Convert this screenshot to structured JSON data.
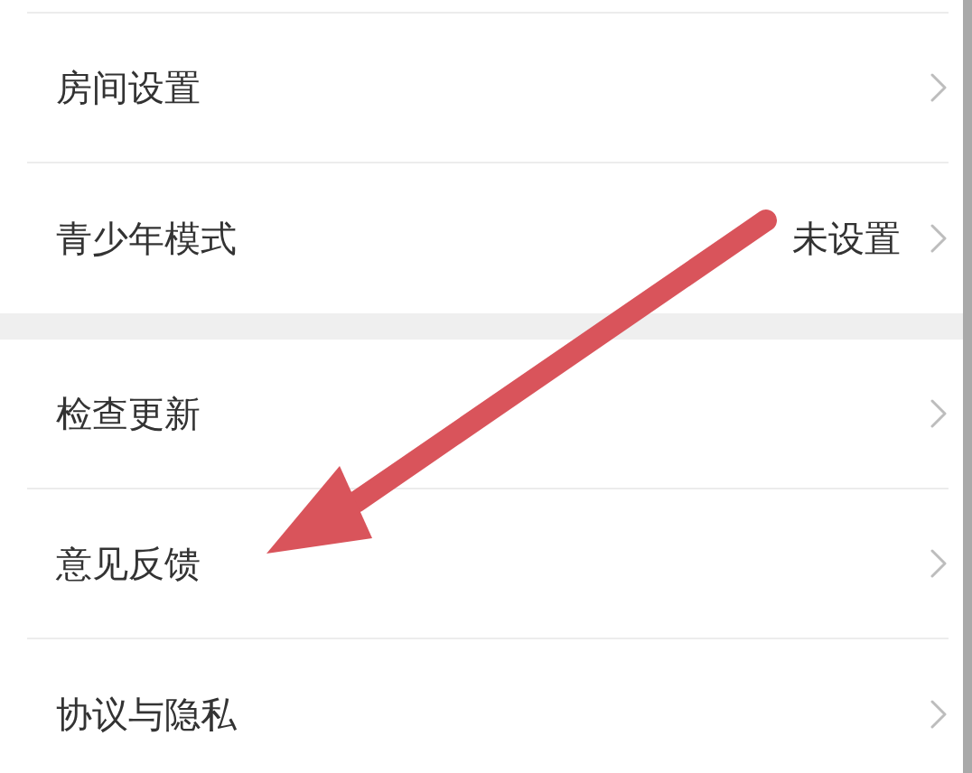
{
  "groups": [
    {
      "items": [
        {
          "label": "房间设置"
        },
        {
          "label": "青少年模式",
          "value": "未设置"
        }
      ]
    },
    {
      "items": [
        {
          "label": "检查更新"
        },
        {
          "label": "意见反馈"
        },
        {
          "label": "协议与隐私"
        }
      ]
    }
  ],
  "annotations": [
    {
      "kind": "arrow"
    }
  ]
}
